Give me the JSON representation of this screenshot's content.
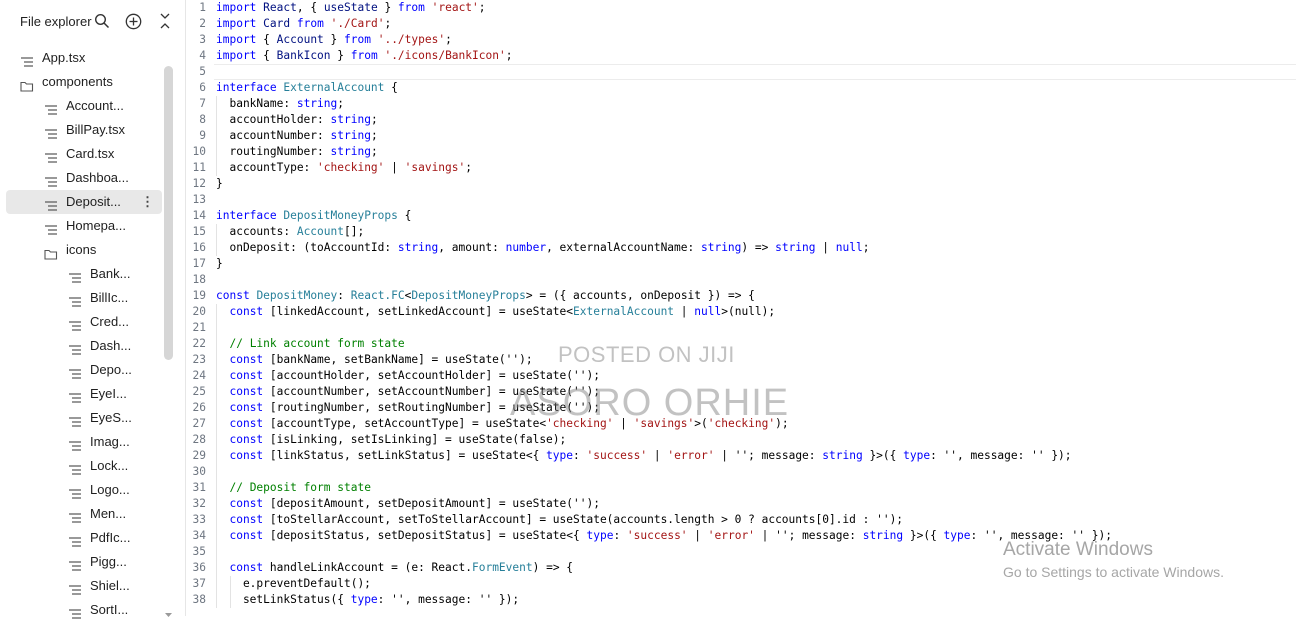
{
  "sidebar": {
    "title": "File explorer",
    "header_icons": [
      "search-icon",
      "add-icon",
      "collapse-icon"
    ],
    "items": [
      {
        "label": "App.tsx",
        "kind": "file",
        "depth": 0
      },
      {
        "label": "components",
        "kind": "folder",
        "depth": 0
      },
      {
        "label": "Account...",
        "kind": "file",
        "depth": 1
      },
      {
        "label": "BillPay.tsx",
        "kind": "file",
        "depth": 1
      },
      {
        "label": "Card.tsx",
        "kind": "file",
        "depth": 1
      },
      {
        "label": "Dashboa...",
        "kind": "file",
        "depth": 1
      },
      {
        "label": "Deposit...",
        "kind": "file",
        "depth": 1,
        "selected": true
      },
      {
        "label": "Homepa...",
        "kind": "file",
        "depth": 1
      },
      {
        "label": "icons",
        "kind": "folder",
        "depth": 1
      },
      {
        "label": "Bank...",
        "kind": "file",
        "depth": 2
      },
      {
        "label": "BillIc...",
        "kind": "file",
        "depth": 2
      },
      {
        "label": "Cred...",
        "kind": "file",
        "depth": 2
      },
      {
        "label": "Dash...",
        "kind": "file",
        "depth": 2
      },
      {
        "label": "Depo...",
        "kind": "file",
        "depth": 2
      },
      {
        "label": "EyeI...",
        "kind": "file",
        "depth": 2
      },
      {
        "label": "EyeS...",
        "kind": "file",
        "depth": 2
      },
      {
        "label": "Imag...",
        "kind": "file",
        "depth": 2
      },
      {
        "label": "Lock...",
        "kind": "file",
        "depth": 2
      },
      {
        "label": "Logo...",
        "kind": "file",
        "depth": 2
      },
      {
        "label": "Men...",
        "kind": "file",
        "depth": 2
      },
      {
        "label": "PdfIc...",
        "kind": "file",
        "depth": 2
      },
      {
        "label": "Pigg...",
        "kind": "file",
        "depth": 2
      },
      {
        "label": "Shiel...",
        "kind": "file",
        "depth": 2
      },
      {
        "label": "SortI...",
        "kind": "file",
        "depth": 2
      }
    ]
  },
  "editor": {
    "cursor_line": 5,
    "lines": [
      {
        "n": "1",
        "indent": 0,
        "tokens": [
          [
            "kw",
            "import"
          ],
          [
            "pl",
            " "
          ],
          [
            "id",
            "React"
          ],
          [
            "pl",
            ", { "
          ],
          [
            "id",
            "useState"
          ],
          [
            "pl",
            " } "
          ],
          [
            "kw",
            "from"
          ],
          [
            "pl",
            " "
          ],
          [
            "str",
            "'react'"
          ],
          [
            "pl",
            ";"
          ]
        ]
      },
      {
        "n": "2",
        "indent": 0,
        "tokens": [
          [
            "kw",
            "import"
          ],
          [
            "pl",
            " "
          ],
          [
            "id",
            "Card"
          ],
          [
            "pl",
            " "
          ],
          [
            "kw",
            "from"
          ],
          [
            "pl",
            " "
          ],
          [
            "str",
            "'./Card'"
          ],
          [
            "pl",
            ";"
          ]
        ]
      },
      {
        "n": "3",
        "indent": 0,
        "tokens": [
          [
            "kw",
            "import"
          ],
          [
            "pl",
            " { "
          ],
          [
            "id",
            "Account"
          ],
          [
            "pl",
            " } "
          ],
          [
            "kw",
            "from"
          ],
          [
            "pl",
            " "
          ],
          [
            "str",
            "'../types'"
          ],
          [
            "pl",
            ";"
          ]
        ]
      },
      {
        "n": "4",
        "indent": 0,
        "tokens": [
          [
            "kw",
            "import"
          ],
          [
            "pl",
            " { "
          ],
          [
            "id",
            "BankIcon"
          ],
          [
            "pl",
            " } "
          ],
          [
            "kw",
            "from"
          ],
          [
            "pl",
            " "
          ],
          [
            "str",
            "'./icons/BankIcon'"
          ],
          [
            "pl",
            ";"
          ]
        ]
      },
      {
        "n": "5",
        "indent": 0,
        "tokens": []
      },
      {
        "n": "6",
        "indent": 0,
        "tokens": [
          [
            "kw",
            "interface"
          ],
          [
            "pl",
            " "
          ],
          [
            "type",
            "ExternalAccount"
          ],
          [
            "pl",
            " {"
          ]
        ]
      },
      {
        "n": "7",
        "indent": 1,
        "tokens": [
          [
            "pl",
            "  bankName: "
          ],
          [
            "kw",
            "string"
          ],
          [
            "pl",
            ";"
          ]
        ]
      },
      {
        "n": "8",
        "indent": 1,
        "tokens": [
          [
            "pl",
            "  accountHolder: "
          ],
          [
            "kw",
            "string"
          ],
          [
            "pl",
            ";"
          ]
        ]
      },
      {
        "n": "9",
        "indent": 1,
        "tokens": [
          [
            "pl",
            "  accountNumber: "
          ],
          [
            "kw",
            "string"
          ],
          [
            "pl",
            ";"
          ]
        ]
      },
      {
        "n": "10",
        "indent": 1,
        "tokens": [
          [
            "pl",
            "  routingNumber: "
          ],
          [
            "kw",
            "string"
          ],
          [
            "pl",
            ";"
          ]
        ]
      },
      {
        "n": "11",
        "indent": 1,
        "tokens": [
          [
            "pl",
            "  accountType: "
          ],
          [
            "str",
            "'checking'"
          ],
          [
            "pl",
            " | "
          ],
          [
            "str",
            "'savings'"
          ],
          [
            "pl",
            ";"
          ]
        ]
      },
      {
        "n": "12",
        "indent": 0,
        "tokens": [
          [
            "pl",
            "}"
          ]
        ]
      },
      {
        "n": "13",
        "indent": 0,
        "tokens": []
      },
      {
        "n": "14",
        "indent": 0,
        "tokens": [
          [
            "kw",
            "interface"
          ],
          [
            "pl",
            " "
          ],
          [
            "type",
            "DepositMoneyProps"
          ],
          [
            "pl",
            " {"
          ]
        ]
      },
      {
        "n": "15",
        "indent": 1,
        "tokens": [
          [
            "pl",
            "  accounts: "
          ],
          [
            "type",
            "Account"
          ],
          [
            "pl",
            "[];"
          ]
        ]
      },
      {
        "n": "16",
        "indent": 1,
        "tokens": [
          [
            "pl",
            "  onDeposit: (toAccountId: "
          ],
          [
            "kw",
            "string"
          ],
          [
            "pl",
            ", amount: "
          ],
          [
            "kw",
            "number"
          ],
          [
            "pl",
            ", externalAccountName: "
          ],
          [
            "kw",
            "string"
          ],
          [
            "pl",
            ") => "
          ],
          [
            "kw",
            "string"
          ],
          [
            "pl",
            " | "
          ],
          [
            "kw",
            "null"
          ],
          [
            "pl",
            ";"
          ]
        ]
      },
      {
        "n": "17",
        "indent": 0,
        "tokens": [
          [
            "pl",
            "}"
          ]
        ]
      },
      {
        "n": "18",
        "indent": 0,
        "tokens": []
      },
      {
        "n": "19",
        "indent": 0,
        "tokens": [
          [
            "kw",
            "const"
          ],
          [
            "pl",
            " "
          ],
          [
            "type",
            "DepositMoney"
          ],
          [
            "pl",
            ": "
          ],
          [
            "type",
            "React.FC"
          ],
          [
            "pl",
            "<"
          ],
          [
            "type",
            "DepositMoneyProps"
          ],
          [
            "pl",
            "> = ({ accounts, onDeposit }) => {"
          ]
        ]
      },
      {
        "n": "20",
        "indent": 1,
        "tokens": [
          [
            "pl",
            "  "
          ],
          [
            "kw",
            "const"
          ],
          [
            "pl",
            " [linkedAccount, setLinkedAccount] = useState<"
          ],
          [
            "type",
            "ExternalAccount"
          ],
          [
            "pl",
            " | "
          ],
          [
            "kw",
            "null"
          ],
          [
            "pl",
            ">(null);"
          ]
        ]
      },
      {
        "n": "21",
        "indent": 1,
        "tokens": []
      },
      {
        "n": "22",
        "indent": 1,
        "tokens": [
          [
            "pl",
            "  "
          ],
          [
            "cm",
            "// Link account form state"
          ]
        ]
      },
      {
        "n": "23",
        "indent": 1,
        "tokens": [
          [
            "pl",
            "  "
          ],
          [
            "kw",
            "const"
          ],
          [
            "pl",
            " [bankName, setBankName] = useState('');"
          ]
        ]
      },
      {
        "n": "24",
        "indent": 1,
        "tokens": [
          [
            "pl",
            "  "
          ],
          [
            "kw",
            "const"
          ],
          [
            "pl",
            " [accountHolder, setAccountHolder] = useState('');"
          ]
        ]
      },
      {
        "n": "25",
        "indent": 1,
        "tokens": [
          [
            "pl",
            "  "
          ],
          [
            "kw",
            "const"
          ],
          [
            "pl",
            " [accountNumber, setAccountNumber] = useState('');"
          ]
        ]
      },
      {
        "n": "26",
        "indent": 1,
        "tokens": [
          [
            "pl",
            "  "
          ],
          [
            "kw",
            "const"
          ],
          [
            "pl",
            " [routingNumber, setRoutingNumber] = useState('');"
          ]
        ]
      },
      {
        "n": "27",
        "indent": 1,
        "tokens": [
          [
            "pl",
            "  "
          ],
          [
            "kw",
            "const"
          ],
          [
            "pl",
            " [accountType, setAccountType] = useState<"
          ],
          [
            "str",
            "'checking'"
          ],
          [
            "pl",
            " | "
          ],
          [
            "str",
            "'savings'"
          ],
          [
            "pl",
            ">("
          ],
          [
            "str",
            "'checking'"
          ],
          [
            "pl",
            ");"
          ]
        ]
      },
      {
        "n": "28",
        "indent": 1,
        "tokens": [
          [
            "pl",
            "  "
          ],
          [
            "kw",
            "const"
          ],
          [
            "pl",
            " [isLinking, setIsLinking] = useState(false);"
          ]
        ]
      },
      {
        "n": "29",
        "indent": 1,
        "tokens": [
          [
            "pl",
            "  "
          ],
          [
            "kw",
            "const"
          ],
          [
            "pl",
            " [linkStatus, setLinkStatus] = useState<{ "
          ],
          [
            "kw",
            "type"
          ],
          [
            "pl",
            ": "
          ],
          [
            "str",
            "'success'"
          ],
          [
            "pl",
            " | "
          ],
          [
            "str",
            "'error'"
          ],
          [
            "pl",
            " | ''; message: "
          ],
          [
            "kw",
            "string"
          ],
          [
            "pl",
            " }>({ "
          ],
          [
            "kw",
            "type"
          ],
          [
            "pl",
            ": '', message: '' });"
          ]
        ]
      },
      {
        "n": "30",
        "indent": 1,
        "tokens": []
      },
      {
        "n": "31",
        "indent": 1,
        "tokens": [
          [
            "pl",
            "  "
          ],
          [
            "cm",
            "// Deposit form state"
          ]
        ]
      },
      {
        "n": "32",
        "indent": 1,
        "tokens": [
          [
            "pl",
            "  "
          ],
          [
            "kw",
            "const"
          ],
          [
            "pl",
            " [depositAmount, setDepositAmount] = useState('');"
          ]
        ]
      },
      {
        "n": "33",
        "indent": 1,
        "tokens": [
          [
            "pl",
            "  "
          ],
          [
            "kw",
            "const"
          ],
          [
            "pl",
            " [toStellarAccount, setToStellarAccount] = useState(accounts.length > 0 ? accounts[0].id : '');"
          ]
        ]
      },
      {
        "n": "34",
        "indent": 1,
        "tokens": [
          [
            "pl",
            "  "
          ],
          [
            "kw",
            "const"
          ],
          [
            "pl",
            " [depositStatus, setDepositStatus] = useState<{ "
          ],
          [
            "kw",
            "type"
          ],
          [
            "pl",
            ": "
          ],
          [
            "str",
            "'success'"
          ],
          [
            "pl",
            " | "
          ],
          [
            "str",
            "'error'"
          ],
          [
            "pl",
            " | ''; message: "
          ],
          [
            "kw",
            "string"
          ],
          [
            "pl",
            " }>({ "
          ],
          [
            "kw",
            "type"
          ],
          [
            "pl",
            ": '', message: '' });"
          ]
        ]
      },
      {
        "n": "35",
        "indent": 1,
        "tokens": []
      },
      {
        "n": "36",
        "indent": 1,
        "tokens": [
          [
            "pl",
            "  "
          ],
          [
            "kw",
            "const"
          ],
          [
            "pl",
            " handleLinkAccount = (e: React."
          ],
          [
            "type",
            "FormEvent"
          ],
          [
            "pl",
            ") => {"
          ]
        ]
      },
      {
        "n": "37",
        "indent": 2,
        "tokens": [
          [
            "pl",
            "    e.preventDefault();"
          ]
        ]
      },
      {
        "n": "38",
        "indent": 2,
        "tokens": [
          [
            "pl",
            "    setLinkStatus({ "
          ],
          [
            "kw",
            "type"
          ],
          [
            "pl",
            ": '', message: '' });"
          ]
        ]
      }
    ]
  },
  "watermark": {
    "line1": "POSTED ON JIJI",
    "line2": "ASORO ORHIE"
  },
  "activation": {
    "title": "Activate Windows",
    "subtitle": "Go to Settings to activate Windows."
  },
  "colors": {
    "keyword": "#0000ff",
    "string": "#a31515",
    "type": "#267f99",
    "comment": "#008000",
    "selected_bg": "#e8e8e8"
  }
}
